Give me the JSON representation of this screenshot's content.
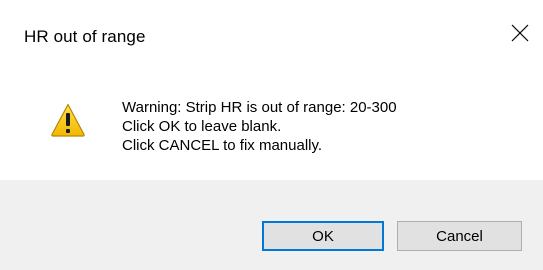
{
  "window": {
    "title": "HR out of range",
    "close_icon": "close-icon"
  },
  "message": {
    "icon": "warning-icon",
    "line1": "Warning: Strip HR is out of range: 20-300",
    "line2": "Click OK to leave blank.",
    "line3": "Click CANCEL to fix manually."
  },
  "buttons": {
    "ok_label": "OK",
    "cancel_label": "Cancel"
  },
  "colors": {
    "footer_bg": "#f0f0f0",
    "default_button_border": "#0078d7",
    "warning_yellow": "#f5c400"
  }
}
